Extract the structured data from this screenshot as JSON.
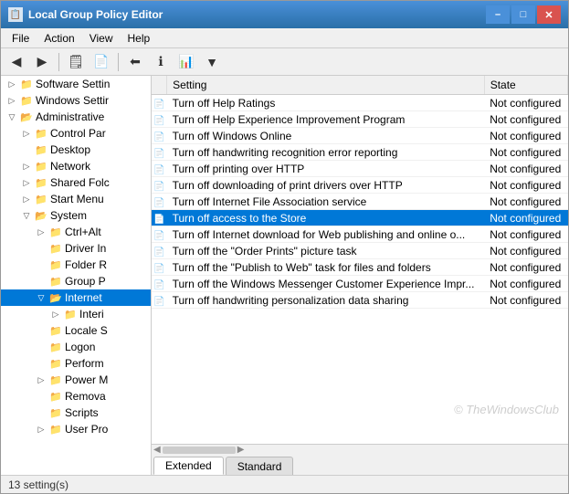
{
  "window": {
    "title": "Local Group Policy Editor",
    "icon": "📋"
  },
  "titlebar": {
    "minimize_label": "–",
    "maximize_label": "□",
    "close_label": "✕"
  },
  "menu": {
    "items": [
      {
        "label": "File"
      },
      {
        "label": "Action"
      },
      {
        "label": "View"
      },
      {
        "label": "Help"
      }
    ]
  },
  "toolbar": {
    "buttons": [
      {
        "icon": "◀",
        "name": "back-button"
      },
      {
        "icon": "▶",
        "name": "forward-button"
      },
      {
        "icon": "⬆",
        "name": "up-button"
      },
      {
        "icon": "🗒",
        "name": "show-hide-button"
      },
      {
        "icon": "📄",
        "name": "new-button"
      },
      {
        "icon": "📋",
        "name": "properties-button"
      },
      {
        "icon": "ℹ",
        "name": "help-button"
      },
      {
        "icon": "📊",
        "name": "toggle-button"
      },
      {
        "icon": "🔽",
        "name": "filter-button"
      }
    ]
  },
  "sidebar": {
    "items": [
      {
        "label": "Software Settin",
        "level": 1,
        "expanded": false,
        "hasChildren": false
      },
      {
        "label": "Windows Settir",
        "level": 1,
        "expanded": false,
        "hasChildren": false
      },
      {
        "label": "Administrative",
        "level": 1,
        "expanded": true,
        "hasChildren": true
      },
      {
        "label": "Control Par",
        "level": 2,
        "expanded": false,
        "hasChildren": false
      },
      {
        "label": "Desktop",
        "level": 2,
        "expanded": false,
        "hasChildren": false
      },
      {
        "label": "Network",
        "level": 2,
        "expanded": false,
        "hasChildren": false
      },
      {
        "label": "Shared Folc",
        "level": 2,
        "expanded": false,
        "hasChildren": false
      },
      {
        "label": "Start Menu",
        "level": 2,
        "expanded": false,
        "hasChildren": false
      },
      {
        "label": "System",
        "level": 2,
        "expanded": true,
        "hasChildren": true
      },
      {
        "label": "Ctrl+Alt",
        "level": 3,
        "expanded": false,
        "hasChildren": false
      },
      {
        "label": "Driver In",
        "level": 3,
        "expanded": false,
        "hasChildren": false
      },
      {
        "label": "Folder R",
        "level": 3,
        "expanded": false,
        "hasChildren": false
      },
      {
        "label": "Group P",
        "level": 3,
        "expanded": false,
        "hasChildren": false
      },
      {
        "label": "Internet",
        "level": 3,
        "expanded": true,
        "hasChildren": true,
        "selected": true
      },
      {
        "label": "Interi",
        "level": 4,
        "expanded": false,
        "hasChildren": false
      },
      {
        "label": "Locale S",
        "level": 3,
        "expanded": false,
        "hasChildren": false
      },
      {
        "label": "Logon",
        "level": 3,
        "expanded": false,
        "hasChildren": false
      },
      {
        "label": "Perform",
        "level": 3,
        "expanded": false,
        "hasChildren": false
      },
      {
        "label": "Power M",
        "level": 3,
        "expanded": false,
        "hasChildren": false
      },
      {
        "label": "Remova",
        "level": 3,
        "expanded": false,
        "hasChildren": false
      },
      {
        "label": "Scripts",
        "level": 3,
        "expanded": false,
        "hasChildren": false
      },
      {
        "label": "User Pro",
        "level": 3,
        "expanded": false,
        "hasChildren": false
      }
    ]
  },
  "table": {
    "columns": [
      {
        "label": "Setting",
        "name": "col-setting"
      },
      {
        "label": "State",
        "name": "col-state"
      }
    ],
    "rows": [
      {
        "setting": "Turn off Help Ratings",
        "state": "Not configured",
        "selected": false
      },
      {
        "setting": "Turn off Help Experience Improvement Program",
        "state": "Not configured",
        "selected": false
      },
      {
        "setting": "Turn off Windows Online",
        "state": "Not configured",
        "selected": false
      },
      {
        "setting": "Turn off handwriting recognition error reporting",
        "state": "Not configured",
        "selected": false
      },
      {
        "setting": "Turn off printing over HTTP",
        "state": "Not configured",
        "selected": false
      },
      {
        "setting": "Turn off downloading of print drivers over HTTP",
        "state": "Not configured",
        "selected": false
      },
      {
        "setting": "Turn off Internet File Association service",
        "state": "Not configured",
        "selected": false
      },
      {
        "setting": "Turn off access to the Store",
        "state": "Not configured",
        "selected": true
      },
      {
        "setting": "Turn off Internet download for Web publishing and online o...",
        "state": "Not configured",
        "selected": false
      },
      {
        "setting": "Turn off the \"Order Prints\" picture task",
        "state": "Not configured",
        "selected": false
      },
      {
        "setting": "Turn off the \"Publish to Web\" task for files and folders",
        "state": "Not configured",
        "selected": false
      },
      {
        "setting": "Turn off the Windows Messenger Customer Experience Impr...",
        "state": "Not configured",
        "selected": false
      },
      {
        "setting": "Turn off handwriting personalization data sharing",
        "state": "Not configured",
        "selected": false
      }
    ]
  },
  "tabs": [
    {
      "label": "Extended",
      "active": true
    },
    {
      "label": "Standard",
      "active": false
    }
  ],
  "status": {
    "text": "13 setting(s)"
  },
  "watermark": {
    "text": "© TheWindowsClub"
  },
  "colors": {
    "selected_bg": "#0078d7",
    "selected_text": "#ffffff",
    "header_bg": "#f0f0f0",
    "titlebar_start": "#4a90d9",
    "titlebar_end": "#2a6fa8"
  }
}
